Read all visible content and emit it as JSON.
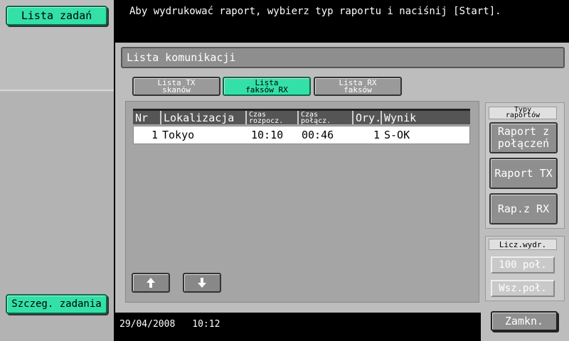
{
  "header": {
    "instruction": "Aby wydrukować raport, wybierz typ raportu i naciśnij [Start]."
  },
  "sidebar": {
    "job_list_label": "Lista zadań",
    "job_details_label": "Szczeg. zadania"
  },
  "panel": {
    "title": "Lista komunikacji",
    "tabs": [
      {
        "line1": "Lista TX",
        "line2": "skanów",
        "active": false
      },
      {
        "line1": "Lista",
        "line2": "faksów RX",
        "active": true
      },
      {
        "line1": "Lista RX",
        "line2": "faksów",
        "active": false
      }
    ]
  },
  "table": {
    "headers": {
      "nr": "Nr",
      "location": "Lokalizacja",
      "start_line1": "Czas",
      "start_line2": "rozpocz.",
      "conn_line1": "Czas",
      "conn_line2": "połącz.",
      "ory": "Ory.",
      "result": "Wynik"
    },
    "rows": [
      {
        "nr": "1",
        "location": "Tokyo",
        "start": "10:10",
        "conn": "00:46",
        "ory": "1",
        "result": "S-OK"
      }
    ]
  },
  "scroll": {
    "up_icon": "arrow-up-icon",
    "down_icon": "arrow-down-icon"
  },
  "report_types": {
    "label_line1": "Typy",
    "label_line2": "raportów",
    "conn_line1": "Raport z",
    "conn_line2": "połączeń",
    "tx": "Raport TX",
    "rx": "Rap.z RX"
  },
  "copies": {
    "label": "Licz.wydr.",
    "value_100": "100 poł.",
    "value_all": "Wsz.poł."
  },
  "footer": {
    "date": "29/04/2008",
    "time": "10:12",
    "close_label": "Zamkn."
  },
  "colors": {
    "accent_green": "#33e0a8",
    "panel_gray": "#bdbdbd"
  }
}
